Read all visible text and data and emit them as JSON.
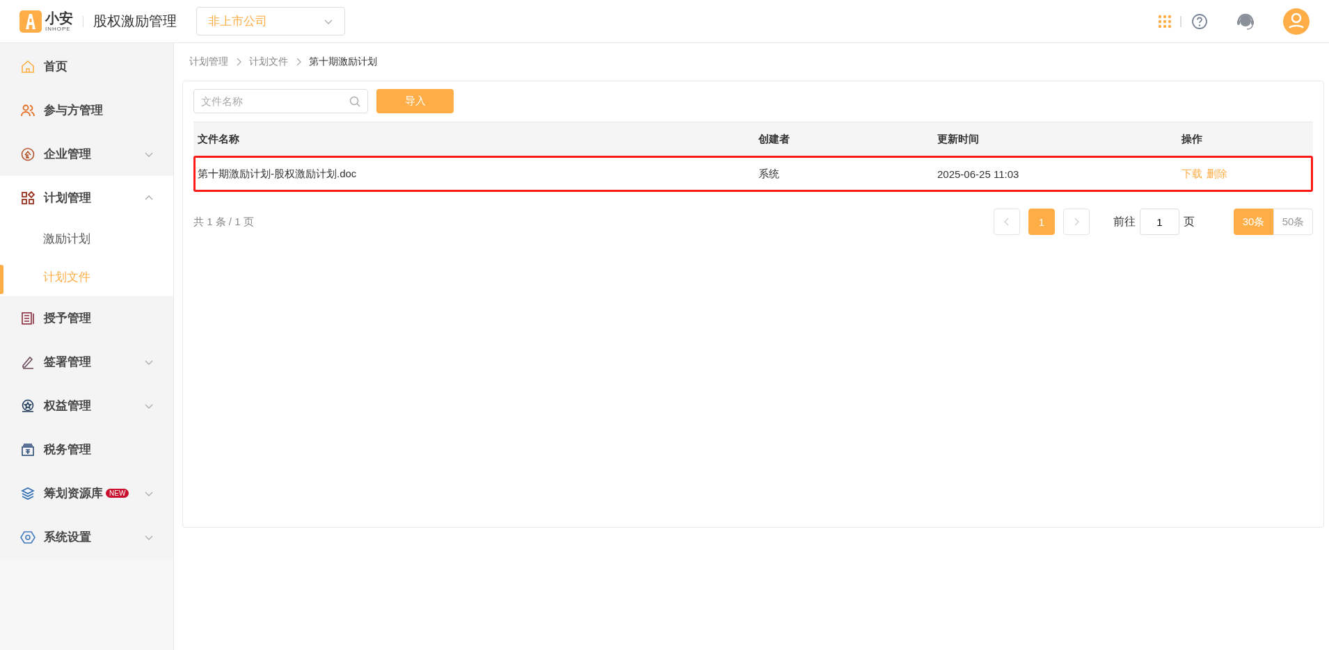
{
  "header": {
    "logo_name": "小安",
    "logo_sub": "INHOPE",
    "app_title": "股权激励管理",
    "company_select": {
      "value": "非上市公司"
    }
  },
  "sidebar": {
    "items": [
      {
        "label": "首页"
      },
      {
        "label": "参与方管理"
      },
      {
        "label": "企业管理",
        "expanded": false
      },
      {
        "label": "计划管理",
        "expanded": true,
        "children": [
          {
            "label": "激励计划",
            "selected": false
          },
          {
            "label": "计划文件",
            "selected": true
          }
        ]
      },
      {
        "label": "授予管理"
      },
      {
        "label": "签署管理",
        "expanded": false
      },
      {
        "label": "权益管理",
        "expanded": false
      },
      {
        "label": "税务管理"
      },
      {
        "label": "筹划资源库",
        "badge": "NEW",
        "expanded": false
      },
      {
        "label": "系统设置",
        "expanded": false
      }
    ]
  },
  "breadcrumb": [
    "计划管理",
    "计划文件",
    "第十期激励计划"
  ],
  "search": {
    "placeholder": "文件名称"
  },
  "import_button": "导入",
  "table": {
    "columns": [
      "文件名称",
      "创建者",
      "更新时间",
      "操作"
    ],
    "rows": [
      {
        "name": "第十期激励计划-股权激励计划.doc",
        "creator": "系统",
        "updated": "2025-06-25 11:03",
        "actions": [
          "下载",
          "删除"
        ],
        "highlighted": true
      }
    ]
  },
  "pagination": {
    "summary": "共 1 条 / 1 页",
    "pages": [
      {
        "label": "1",
        "selected": true
      }
    ],
    "goto_label": "前往",
    "goto_value": "1",
    "goto_suffix": "页",
    "sizes": [
      {
        "label": "30条",
        "selected": true
      },
      {
        "label": "50条",
        "selected": false
      }
    ]
  }
}
